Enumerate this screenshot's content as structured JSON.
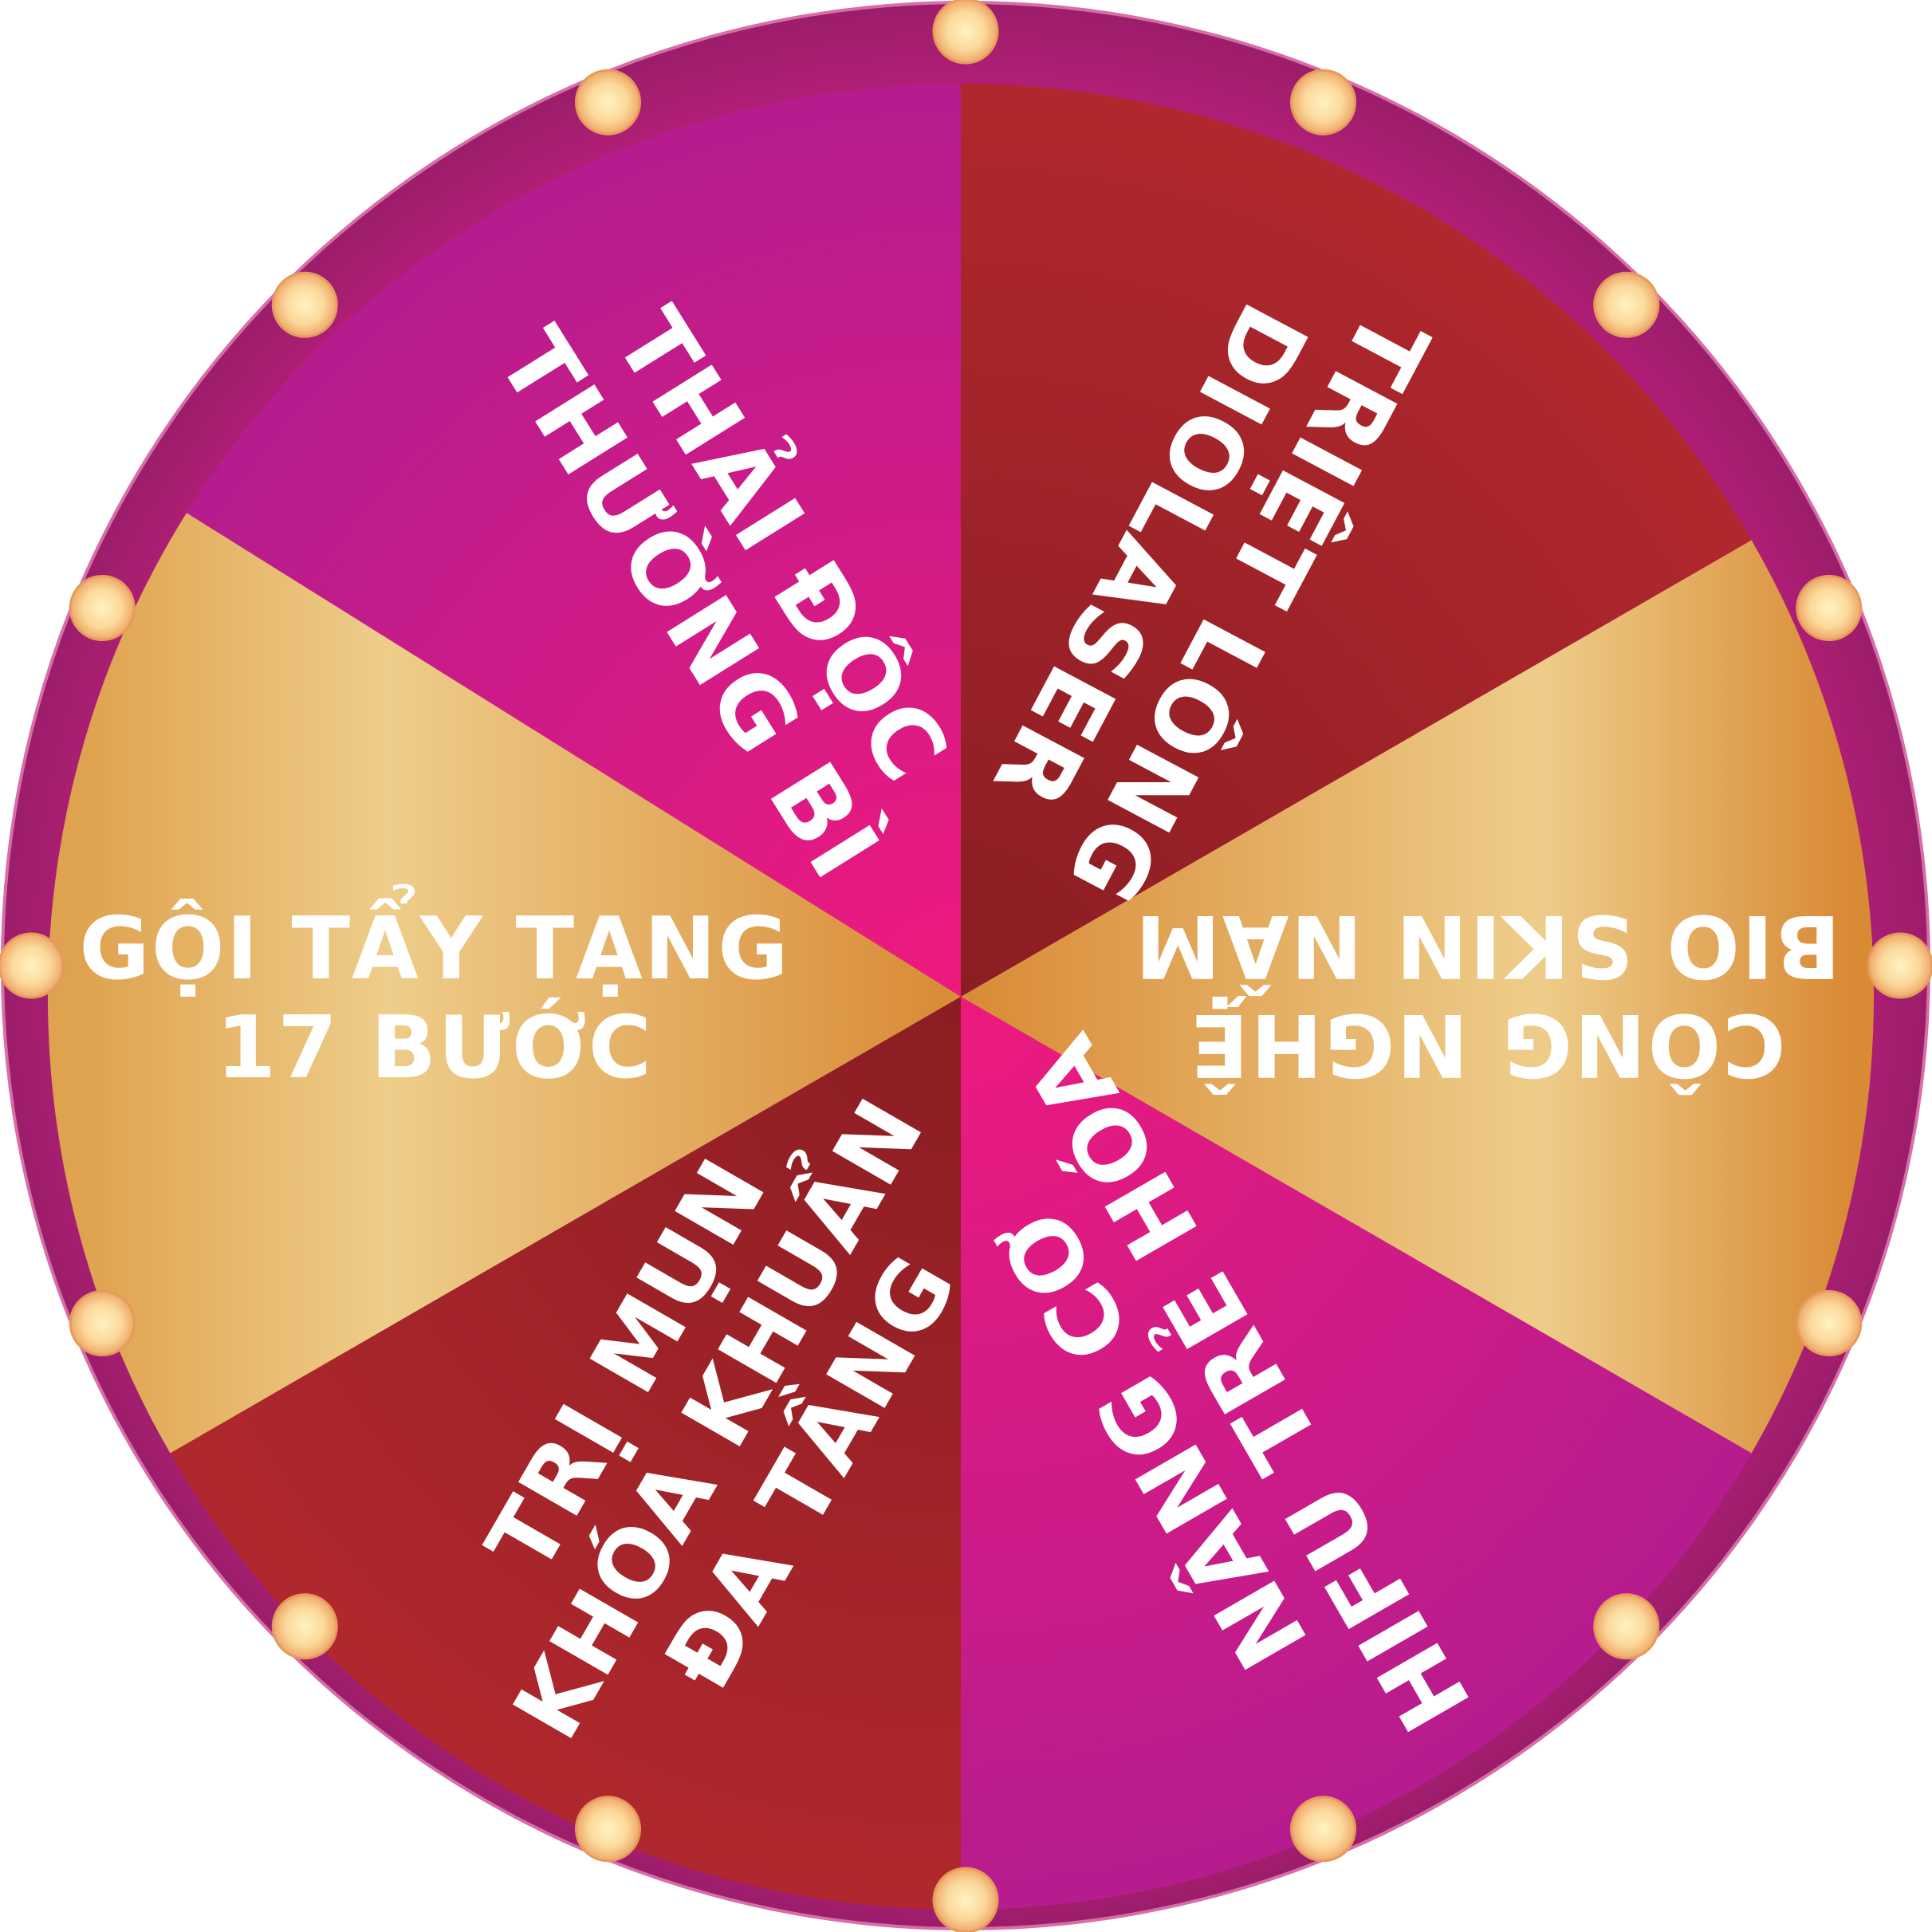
{
  "wheel": {
    "segments": [
      {
        "lines": [
          "THẢI ĐỘC",
          "THƯỜNG BÌ"
        ],
        "color": "magenta"
      },
      {
        "lines": [
          "TRIỆT LÔNG",
          "DIOLASER"
        ],
        "color": "maroon"
      },
      {
        "lines": [
          "CÔNG NGHỆ",
          "BIO SKIN NẤM"
        ],
        "color": "gold"
      },
      {
        "lines": [
          "NÂNG CƠ",
          "HIFU TRẺ HÓA"
        ],
        "color": "magenta"
      },
      {
        "lines": [
          "TRỊ MỤN",
          "KHÓA KHUẨN",
          "ĐA TẦNG"
        ],
        "color": "maroon"
      },
      {
        "lines": [
          "GỘI TẨY TẠNG",
          "17 BƯỚC"
        ],
        "color": "gold"
      }
    ],
    "colors": {
      "rim": "#9b1d6a",
      "rim_light": "#c81f75",
      "magenta_start": "#b51c8e",
      "magenta_end": "#ee1a7e",
      "maroon_start": "#8a1d23",
      "maroon_end": "#b0282d",
      "gold_start": "#d98a35",
      "gold_mid": "#eecd8a",
      "bulb": "#f6c37c",
      "bulb_center": "#fff3c2"
    },
    "bulb_count": 16
  }
}
